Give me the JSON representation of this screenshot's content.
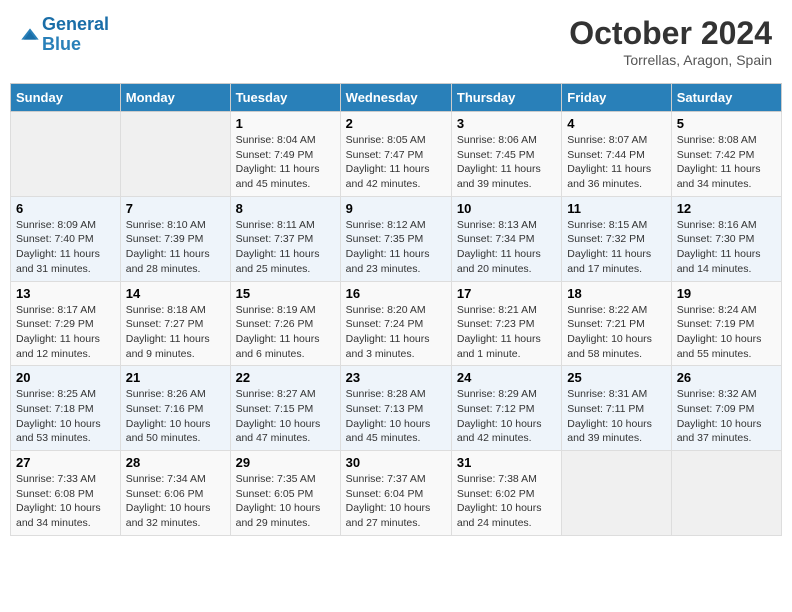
{
  "logo": {
    "line1": "General",
    "line2": "Blue"
  },
  "title": "October 2024",
  "subtitle": "Torrellas, Aragon, Spain",
  "days_of_week": [
    "Sunday",
    "Monday",
    "Tuesday",
    "Wednesday",
    "Thursday",
    "Friday",
    "Saturday"
  ],
  "weeks": [
    [
      {
        "day": null,
        "info": null
      },
      {
        "day": null,
        "info": null
      },
      {
        "day": "1",
        "info": "Sunrise: 8:04 AM\nSunset: 7:49 PM\nDaylight: 11 hours and 45 minutes."
      },
      {
        "day": "2",
        "info": "Sunrise: 8:05 AM\nSunset: 7:47 PM\nDaylight: 11 hours and 42 minutes."
      },
      {
        "day": "3",
        "info": "Sunrise: 8:06 AM\nSunset: 7:45 PM\nDaylight: 11 hours and 39 minutes."
      },
      {
        "day": "4",
        "info": "Sunrise: 8:07 AM\nSunset: 7:44 PM\nDaylight: 11 hours and 36 minutes."
      },
      {
        "day": "5",
        "info": "Sunrise: 8:08 AM\nSunset: 7:42 PM\nDaylight: 11 hours and 34 minutes."
      }
    ],
    [
      {
        "day": "6",
        "info": "Sunrise: 8:09 AM\nSunset: 7:40 PM\nDaylight: 11 hours and 31 minutes."
      },
      {
        "day": "7",
        "info": "Sunrise: 8:10 AM\nSunset: 7:39 PM\nDaylight: 11 hours and 28 minutes."
      },
      {
        "day": "8",
        "info": "Sunrise: 8:11 AM\nSunset: 7:37 PM\nDaylight: 11 hours and 25 minutes."
      },
      {
        "day": "9",
        "info": "Sunrise: 8:12 AM\nSunset: 7:35 PM\nDaylight: 11 hours and 23 minutes."
      },
      {
        "day": "10",
        "info": "Sunrise: 8:13 AM\nSunset: 7:34 PM\nDaylight: 11 hours and 20 minutes."
      },
      {
        "day": "11",
        "info": "Sunrise: 8:15 AM\nSunset: 7:32 PM\nDaylight: 11 hours and 17 minutes."
      },
      {
        "day": "12",
        "info": "Sunrise: 8:16 AM\nSunset: 7:30 PM\nDaylight: 11 hours and 14 minutes."
      }
    ],
    [
      {
        "day": "13",
        "info": "Sunrise: 8:17 AM\nSunset: 7:29 PM\nDaylight: 11 hours and 12 minutes."
      },
      {
        "day": "14",
        "info": "Sunrise: 8:18 AM\nSunset: 7:27 PM\nDaylight: 11 hours and 9 minutes."
      },
      {
        "day": "15",
        "info": "Sunrise: 8:19 AM\nSunset: 7:26 PM\nDaylight: 11 hours and 6 minutes."
      },
      {
        "day": "16",
        "info": "Sunrise: 8:20 AM\nSunset: 7:24 PM\nDaylight: 11 hours and 3 minutes."
      },
      {
        "day": "17",
        "info": "Sunrise: 8:21 AM\nSunset: 7:23 PM\nDaylight: 11 hours and 1 minute."
      },
      {
        "day": "18",
        "info": "Sunrise: 8:22 AM\nSunset: 7:21 PM\nDaylight: 10 hours and 58 minutes."
      },
      {
        "day": "19",
        "info": "Sunrise: 8:24 AM\nSunset: 7:19 PM\nDaylight: 10 hours and 55 minutes."
      }
    ],
    [
      {
        "day": "20",
        "info": "Sunrise: 8:25 AM\nSunset: 7:18 PM\nDaylight: 10 hours and 53 minutes."
      },
      {
        "day": "21",
        "info": "Sunrise: 8:26 AM\nSunset: 7:16 PM\nDaylight: 10 hours and 50 minutes."
      },
      {
        "day": "22",
        "info": "Sunrise: 8:27 AM\nSunset: 7:15 PM\nDaylight: 10 hours and 47 minutes."
      },
      {
        "day": "23",
        "info": "Sunrise: 8:28 AM\nSunset: 7:13 PM\nDaylight: 10 hours and 45 minutes."
      },
      {
        "day": "24",
        "info": "Sunrise: 8:29 AM\nSunset: 7:12 PM\nDaylight: 10 hours and 42 minutes."
      },
      {
        "day": "25",
        "info": "Sunrise: 8:31 AM\nSunset: 7:11 PM\nDaylight: 10 hours and 39 minutes."
      },
      {
        "day": "26",
        "info": "Sunrise: 8:32 AM\nSunset: 7:09 PM\nDaylight: 10 hours and 37 minutes."
      }
    ],
    [
      {
        "day": "27",
        "info": "Sunrise: 7:33 AM\nSunset: 6:08 PM\nDaylight: 10 hours and 34 minutes."
      },
      {
        "day": "28",
        "info": "Sunrise: 7:34 AM\nSunset: 6:06 PM\nDaylight: 10 hours and 32 minutes."
      },
      {
        "day": "29",
        "info": "Sunrise: 7:35 AM\nSunset: 6:05 PM\nDaylight: 10 hours and 29 minutes."
      },
      {
        "day": "30",
        "info": "Sunrise: 7:37 AM\nSunset: 6:04 PM\nDaylight: 10 hours and 27 minutes."
      },
      {
        "day": "31",
        "info": "Sunrise: 7:38 AM\nSunset: 6:02 PM\nDaylight: 10 hours and 24 minutes."
      },
      {
        "day": null,
        "info": null
      },
      {
        "day": null,
        "info": null
      }
    ]
  ]
}
